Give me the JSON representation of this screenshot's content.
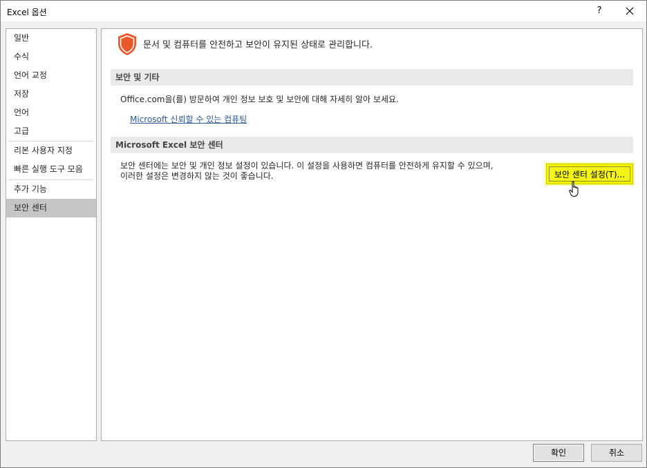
{
  "window": {
    "title": "Excel 옵션",
    "help_label": "?"
  },
  "sidebar": {
    "items": [
      {
        "label": "일반"
      },
      {
        "label": "수식"
      },
      {
        "label": "언어 교정"
      },
      {
        "label": "저장"
      },
      {
        "label": "언어"
      },
      {
        "label": "고급"
      },
      {
        "label": "리본 사용자 지정"
      },
      {
        "label": "빠른 실행 도구 모음"
      },
      {
        "label": "추가 기능"
      },
      {
        "label": "보안 센터"
      }
    ],
    "selected": "보안 센터"
  },
  "main": {
    "header": "문서 및 컴퓨터를 안전하고 보안이 유지된 상태로 관리합니다.",
    "section_security": {
      "title": "보안 및 기타",
      "info": "Office.com을(를) 방문하여 개인 정보 보호 및 보안에 대해 자세히 알아 보세요.",
      "link": "Microsoft 신뢰할 수 있는 컴퓨팅"
    },
    "section_trust_center": {
      "title": "Microsoft Excel 보안 센터",
      "desc_line1": "보안 센터에는 보안 및 개인 정보 설정이 있습니다. 이 설정을 사용하면 컴퓨터를 안전하게 유지할 수 있으며,",
      "desc_line2": "이러한 설정은 변경하지 않는 것이 좋습니다.",
      "button_label": "보안 센터 설정(T)..."
    }
  },
  "footer": {
    "ok_label": "확인",
    "cancel_label": "취소"
  },
  "colors": {
    "shield": "#e8582b",
    "highlight": "#f5f500",
    "link": "#2b579a",
    "selected_nav": "#c5c5c5"
  }
}
